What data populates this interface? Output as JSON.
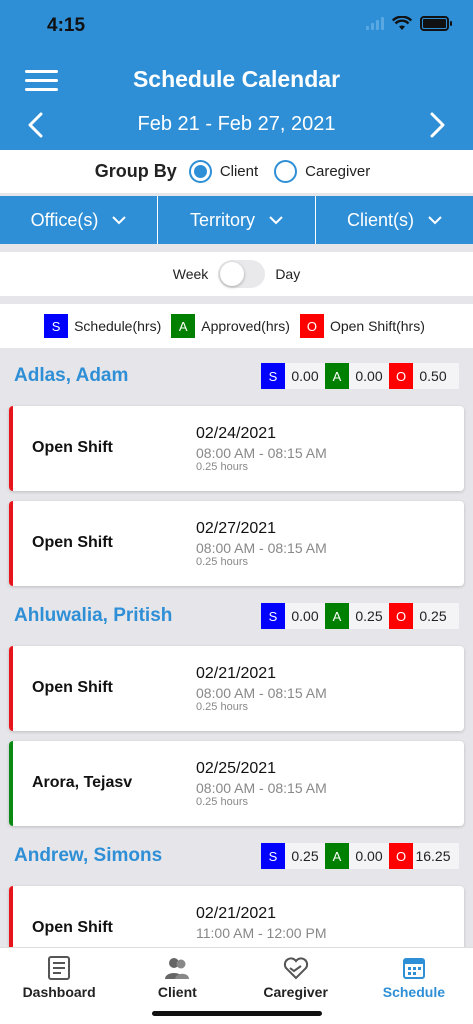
{
  "status": {
    "time": "4:15"
  },
  "header": {
    "title": "Schedule Calendar",
    "date_range": "Feb 21 - Feb 27, 2021"
  },
  "group_by": {
    "label": "Group By",
    "options": [
      "Client",
      "Caregiver"
    ],
    "selected": "Client"
  },
  "filters": [
    "Office(s)",
    "Territory",
    "Client(s)"
  ],
  "view_toggle": {
    "left": "Week",
    "right": "Day",
    "on": false
  },
  "legend": [
    {
      "code": "S",
      "label": "Schedule(hrs)",
      "color": "#0000ff"
    },
    {
      "code": "A",
      "label": "Approved(hrs)",
      "color": "#008000"
    },
    {
      "code": "O",
      "label": "Open Shift(hrs)",
      "color": "#ff0000"
    }
  ],
  "groups": [
    {
      "name": "Adlas, Adam",
      "totals": {
        "S": "0.00",
        "A": "0.00",
        "O": "0.50"
      },
      "shifts": [
        {
          "title": "Open Shift",
          "date": "02/24/2021",
          "time": "08:00 AM - 08:15 AM",
          "hours": "0.25 hours",
          "status_color": "#e8141b"
        },
        {
          "title": "Open Shift",
          "date": "02/27/2021",
          "time": "08:00 AM - 08:15 AM",
          "hours": "0.25 hours",
          "status_color": "#e8141b"
        }
      ]
    },
    {
      "name": "Ahluwalia, Pritish",
      "totals": {
        "S": "0.00",
        "A": "0.25",
        "O": "0.25"
      },
      "shifts": [
        {
          "title": "Open Shift",
          "date": "02/21/2021",
          "time": "08:00 AM - 08:15 AM",
          "hours": "0.25 hours",
          "status_color": "#e8141b"
        },
        {
          "title": "Arora, Tejasv",
          "date": "02/25/2021",
          "time": "08:00 AM - 08:15 AM",
          "hours": "0.25 hours",
          "status_color": "#0a8a12"
        }
      ]
    },
    {
      "name": "Andrew, Simons",
      "totals": {
        "S": "0.25",
        "A": "0.00",
        "O": "16.25"
      },
      "shifts": [
        {
          "title": "Open Shift",
          "date": "02/21/2021",
          "time": "11:00 AM - 12:00 PM",
          "hours": "",
          "status_color": "#e8141b"
        }
      ]
    }
  ],
  "tabs": [
    {
      "label": "Dashboard",
      "icon": "dashboard-icon",
      "active": false
    },
    {
      "label": "Client",
      "icon": "client-icon",
      "active": false
    },
    {
      "label": "Caregiver",
      "icon": "caregiver-icon",
      "active": false
    },
    {
      "label": "Schedule",
      "icon": "schedule-icon",
      "active": true
    }
  ],
  "colors": {
    "primary": "#2e8fd6",
    "open": "#e8141b",
    "approved": "#0a8a12",
    "schedule": "#0000ff"
  }
}
